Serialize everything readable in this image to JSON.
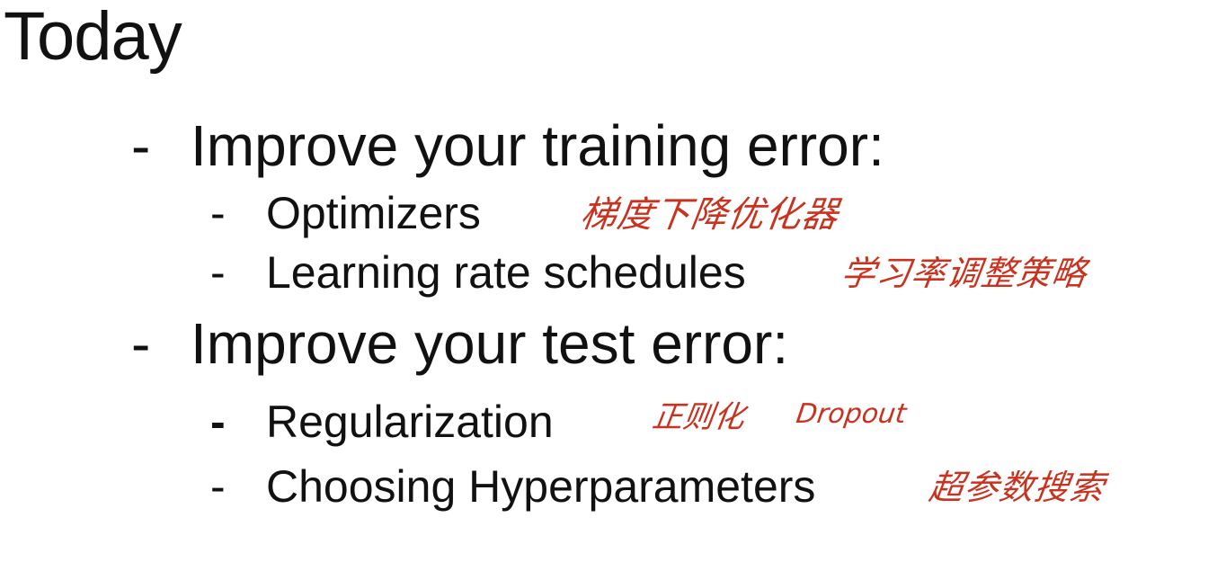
{
  "slide": {
    "title": "Today",
    "dash": "-",
    "sections": [
      {
        "heading": "Improve your training error:",
        "items": [
          {
            "label": "Optimizers",
            "note": "梯度下降优化器"
          },
          {
            "label": "Learning rate schedules",
            "note": "学习率调整策略"
          }
        ]
      },
      {
        "heading": "Improve your test error:",
        "items": [
          {
            "label": "Regularization",
            "note": "正则化",
            "note2": "Dropout"
          },
          {
            "label": "Choosing Hyperparameters",
            "note": "超参数搜索"
          }
        ]
      }
    ]
  },
  "colors": {
    "text": "#111111",
    "annotation": "#c8321e",
    "background": "#ffffff"
  }
}
